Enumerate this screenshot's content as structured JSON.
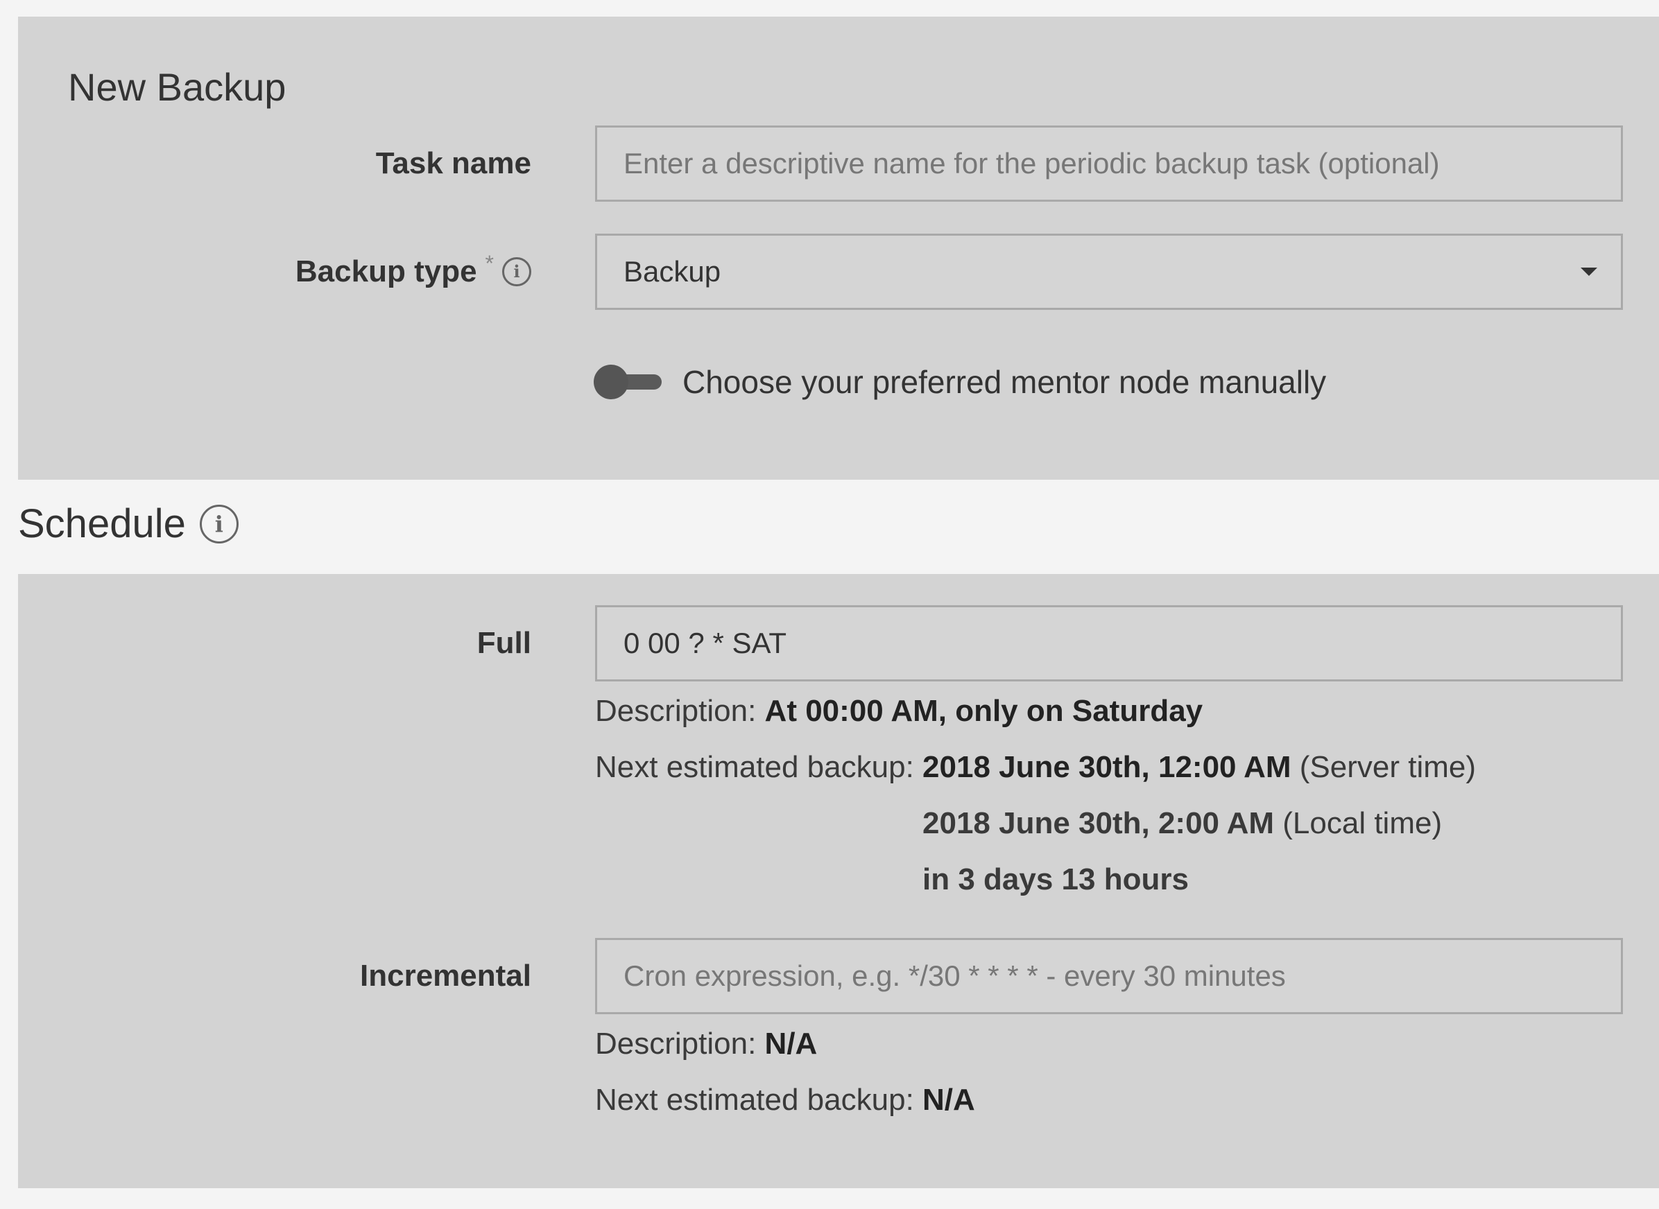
{
  "new_backup": {
    "title": "New Backup",
    "task_name": {
      "label": "Task name",
      "placeholder": "Enter a descriptive name for the periodic backup task (optional)",
      "value": ""
    },
    "backup_type": {
      "label": "Backup type",
      "required_mark": "*",
      "selected": "Backup"
    },
    "mentor_toggle": {
      "label": "Choose your preferred mentor node manually",
      "enabled": false
    }
  },
  "schedule": {
    "title": "Schedule",
    "full": {
      "label": "Full",
      "value": "0 00 ? * SAT",
      "description_label": "Description:",
      "description_value": "At 00:00 AM, only on Saturday",
      "next_label": "Next estimated backup:",
      "server_time_value": "2018 June 30th, 12:00 AM",
      "server_time_suffix": "(Server time)",
      "local_time_value": "2018 June 30th, 2:00 AM",
      "local_time_suffix": "(Local time)",
      "relative": "in 3 days 13 hours"
    },
    "incremental": {
      "label": "Incremental",
      "placeholder": "Cron expression, e.g. */30 * * * * - every 30 minutes",
      "value": "",
      "description_label": "Description:",
      "description_value": "N/A",
      "next_label": "Next estimated backup:",
      "next_value": "N/A"
    }
  },
  "icons": {
    "info": "info-icon",
    "dropdown": "chevron-down-icon"
  },
  "colors": {
    "page_background": "#f4f4f4",
    "panel_background": "#d3d3d3",
    "text": "#333333"
  }
}
